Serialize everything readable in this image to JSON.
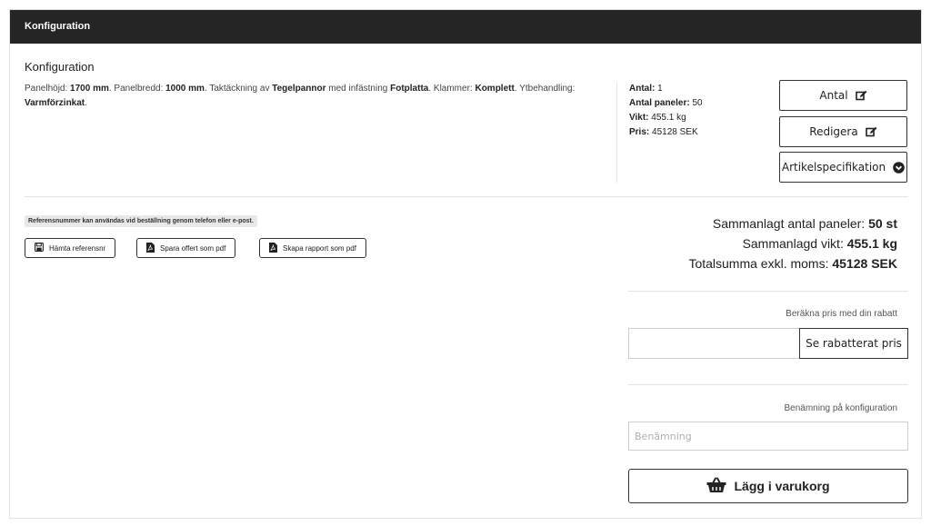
{
  "header": {
    "title": "Konfiguration"
  },
  "config": {
    "title": "Konfiguration",
    "desc": {
      "panelhojd_label": "Panelhöjd: ",
      "panelhojd_value": "1700 mm",
      "panelbredd_label": ". Panelbredd: ",
      "panelbredd_value": "1000 mm",
      "takt_label": ". Taktäckning av ",
      "takt_value": "Tegelpannor",
      "infast_label": " med infästning ",
      "infast_value": "Fotplatta",
      "klammer_label": ". Klammer: ",
      "klammer_value": "Komplett",
      "ytb_label": ". Ytbehandling: ",
      "ytb_value": "Varmförzinkat",
      "end": "."
    }
  },
  "stats": {
    "antal_label": "Antal:",
    "antal_value": " 1",
    "paneler_label": "Antal paneler:",
    "paneler_value": " 50",
    "vikt_label": "Vikt:",
    "vikt_value": " 455.1 kg",
    "pris_label": "Pris:",
    "pris_value": " 45128 SEK"
  },
  "actions": {
    "antal": "Antal",
    "redigera": "Redigera",
    "artikel": "Artikelspecifikation"
  },
  "reference": {
    "note": "Referensnummer kan användas vid beställning genom telefon eller e-post.",
    "hamta": "Hämta referensnr",
    "spara_pdf": "Spara offert som pdf",
    "rapport_pdf": "Skapa rapport som pdf"
  },
  "totals": {
    "paneler_label": "Sammanlagt antal paneler: ",
    "paneler_value": "50 st",
    "vikt_label": "Sammanlagd vikt: ",
    "vikt_value": "455.1 kg",
    "summa_label": "Totalsumma exkl. moms: ",
    "summa_value": "45128 SEK"
  },
  "discount": {
    "label": "Beräkna pris med din rabatt",
    "input_value": "",
    "button": "Se rabatterat pris"
  },
  "naming": {
    "label": "Benämning på konfiguration",
    "placeholder": "Benämning"
  },
  "cart": {
    "button": "Lägg i varukorg"
  }
}
